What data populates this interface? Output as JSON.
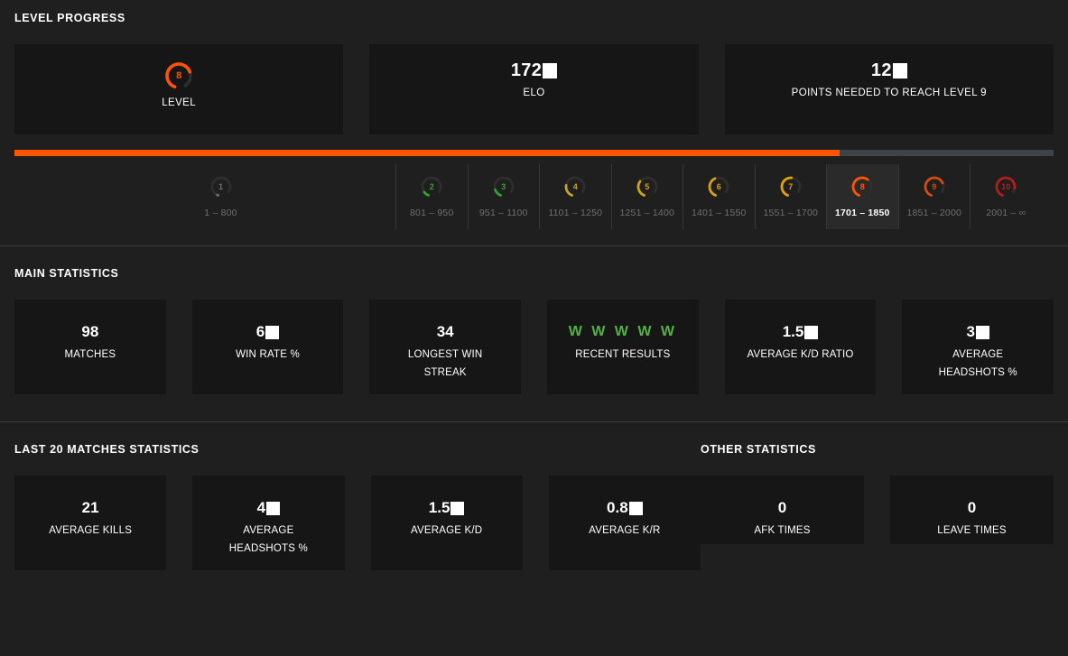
{
  "sections": {
    "level_progress": {
      "title": "LEVEL PROGRESS"
    },
    "main_statistics": {
      "title": "MAIN STATISTICS"
    },
    "last20": {
      "title": "LAST 20 MATCHES STATISTICS"
    },
    "other": {
      "title": "OTHER STATISTICS"
    }
  },
  "colors": {
    "accent_orange": "#ff5500",
    "win_green": "#53b043",
    "level_grey": "#6f6f6f",
    "level_green": "#34a12a",
    "level_yellow": "#d4a017",
    "level_red": "#b01e1e",
    "card_bg": "#161616",
    "page_bg": "#1f1f1f",
    "track_grey": "#3d4347"
  },
  "top_cards": [
    {
      "name": "level",
      "value": "8",
      "redacted": false,
      "caption": "LEVEL",
      "type": "gauge"
    },
    {
      "name": "elo",
      "value": "172",
      "redacted": true,
      "caption": "ELO",
      "type": "number"
    },
    {
      "name": "points-needed",
      "value": "12",
      "redacted": true,
      "caption": "POINTS NEEDED TO REACH LEVEL 9",
      "type": "number"
    }
  ],
  "progress": {
    "percent": 79.4,
    "current_level": 8,
    "icon": "progress-bar"
  },
  "levels": [
    {
      "level": "1",
      "range": "1 – 800",
      "color": "#6f6f6f",
      "arc": 2,
      "active": false
    },
    {
      "level": "2",
      "range": "801 – 950",
      "color": "#34a12a",
      "arc": 12,
      "active": false
    },
    {
      "level": "3",
      "range": "951 – 1100",
      "color": "#34a12a",
      "arc": 18,
      "active": false
    },
    {
      "level": "4",
      "range": "1101 – 1250",
      "color": "#c9a227",
      "arc": 28,
      "active": false
    },
    {
      "level": "5",
      "range": "1251 – 1400",
      "color": "#d4a017",
      "arc": 38,
      "active": false
    },
    {
      "level": "6",
      "range": "1401 – 1550",
      "color": "#d8a408",
      "arc": 48,
      "active": false
    },
    {
      "level": "7",
      "range": "1551 – 1700",
      "color": "#dfa300",
      "arc": 58,
      "active": false
    },
    {
      "level": "8",
      "range": "1701 – 1850",
      "color": "#ff5500",
      "arc": 70,
      "active": true
    },
    {
      "level": "9",
      "range": "1851 – 2000",
      "color": "#d14a12",
      "arc": 80,
      "active": false
    },
    {
      "level": "10",
      "range": "2001 – ∞",
      "color": "#b01e1e",
      "arc": 92,
      "active": false
    }
  ],
  "main_stats": [
    {
      "value": "98",
      "redacted": false,
      "label": "MATCHES",
      "style": "plain"
    },
    {
      "value": "6",
      "redacted": true,
      "label": "WIN RATE %",
      "style": "plain"
    },
    {
      "value": "34",
      "redacted": false,
      "label": "LONGEST WIN STREAK",
      "style": "plain"
    },
    {
      "value": "W W W W W",
      "redacted": false,
      "label": "RECENT RESULTS",
      "style": "results"
    },
    {
      "value": "1.5",
      "redacted": true,
      "label": "AVERAGE K/D RATIO",
      "style": "plain"
    },
    {
      "value": "3",
      "redacted": true,
      "label": "AVERAGE HEADSHOTS %",
      "style": "plain"
    }
  ],
  "last20_stats": [
    {
      "value": "21",
      "redacted": false,
      "label": "AVERAGE KILLS"
    },
    {
      "value": "4",
      "redacted": true,
      "label": "AVERAGE HEADSHOTS %"
    },
    {
      "value": "1.5",
      "redacted": true,
      "label": "AVERAGE K/D"
    },
    {
      "value": "0.8",
      "redacted": true,
      "label": "AVERAGE K/R"
    }
  ],
  "other_stats": [
    {
      "value": "0",
      "redacted": false,
      "label": "AFK TIMES"
    },
    {
      "value": "0",
      "redacted": false,
      "label": "LEAVE TIMES"
    }
  ]
}
